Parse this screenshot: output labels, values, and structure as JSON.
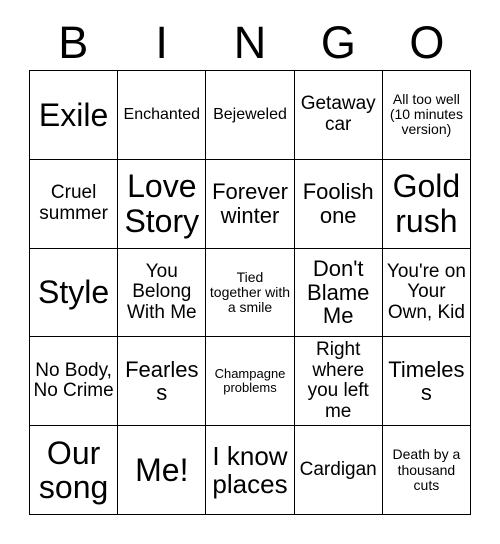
{
  "card": {
    "type": "bingo-card",
    "theme_colors": {
      "background": "#ffffff",
      "text": "#000000",
      "grid_line": "#000000"
    },
    "header": {
      "letters": [
        "B",
        "I",
        "N",
        "G",
        "O"
      ]
    },
    "grid": {
      "columns": 5,
      "rows": 5,
      "cells": [
        [
          {
            "text": "Exile",
            "size": "fs-xxl"
          },
          {
            "text": "Enchanted",
            "size": "fs-sm"
          },
          {
            "text": "Bejeweled",
            "size": "fs-sm"
          },
          {
            "text": "Getaway car",
            "size": "fs-md"
          },
          {
            "text": "All too well (10 minutes version)",
            "size": "fs-xs"
          }
        ],
        [
          {
            "text": "Cruel summer",
            "size": "fs-md"
          },
          {
            "text": "Love Story",
            "size": "fs-xxl"
          },
          {
            "text": "Forever winter",
            "size": "fs-lg"
          },
          {
            "text": "Foolish one",
            "size": "fs-lg"
          },
          {
            "text": "Gold rush",
            "size": "fs-xxl"
          }
        ],
        [
          {
            "text": "Style",
            "size": "fs-xxl"
          },
          {
            "text": "You Belong With Me",
            "size": "fs-md"
          },
          {
            "text": "Tied together with a smile",
            "size": "fs-xs"
          },
          {
            "text": "Don't Blame Me",
            "size": "fs-lg"
          },
          {
            "text": "You're on Your Own, Kid",
            "size": "fs-md"
          }
        ],
        [
          {
            "text": "No Body, No Crime",
            "size": "fs-md"
          },
          {
            "text": "Fearless",
            "size": "fs-lg"
          },
          {
            "text": "Champagne problems",
            "size": "fs-xxs"
          },
          {
            "text": "Right where you left me",
            "size": "fs-md"
          },
          {
            "text": "Timeless",
            "size": "fs-lg"
          }
        ],
        [
          {
            "text": "Our song",
            "size": "fs-xxl"
          },
          {
            "text": "Me!",
            "size": "fs-xxl"
          },
          {
            "text": "I know places",
            "size": "fs-xl"
          },
          {
            "text": "Cardigan",
            "size": "fs-md"
          },
          {
            "text": "Death by a thousand cuts",
            "size": "fs-xs"
          }
        ]
      ]
    }
  }
}
